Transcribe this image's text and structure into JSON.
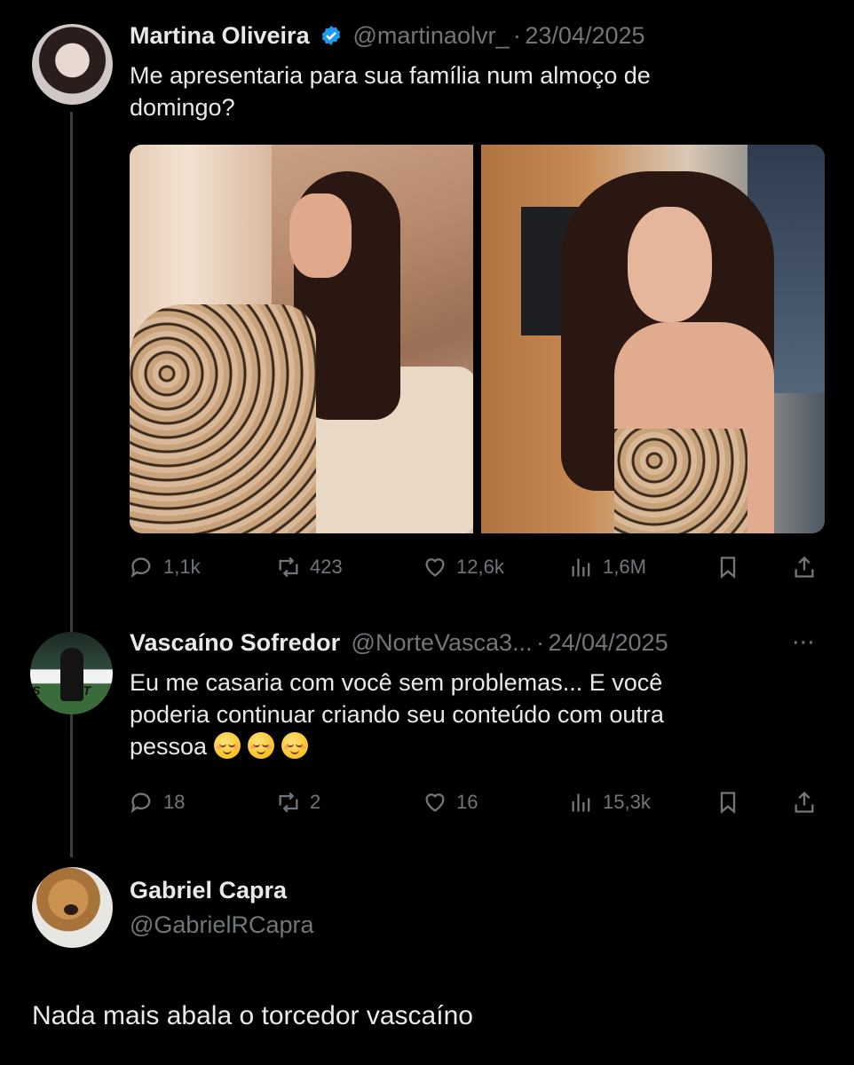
{
  "tweets": [
    {
      "name": "Martina Oliveira",
      "verified": true,
      "handle": "@martinaolvr_",
      "separator": "·",
      "date": "23/04/2025",
      "text_lines": [
        "Me apresentaria para sua família num almoço de",
        "domingo?"
      ],
      "stats": {
        "replies": "1,1k",
        "reposts": "423",
        "likes": "12,6k",
        "views": "1,6M"
      }
    },
    {
      "name": "Vascaíno Sofredor",
      "handle": "@NorteVasca3...",
      "separator": "·",
      "date": "24/04/2025",
      "text_lines": [
        "Eu me casaria com você sem problemas... E você",
        "poderia continuar criando seu conteúdo com outra",
        "pessoa"
      ],
      "emoji_count": 3,
      "stats": {
        "replies": "18",
        "reposts": "2",
        "likes": "16",
        "views": "15,3k"
      }
    }
  ],
  "quote_author": {
    "name": "Gabriel Capra",
    "handle": "@GabrielRCapra"
  },
  "caption": "Nada mais abala o torcedor vascaíno",
  "icons": {
    "reply": "reply-icon",
    "repost": "repost-icon",
    "like": "heart-icon",
    "views": "views-icon",
    "bookmark": "bookmark-icon",
    "share": "share-icon",
    "more": "more-icon",
    "verified": "verified-badge-icon"
  },
  "colors": {
    "background": "#000000",
    "text": "#e7e9ea",
    "muted": "#71767b",
    "verified": "#1d9bf0"
  }
}
